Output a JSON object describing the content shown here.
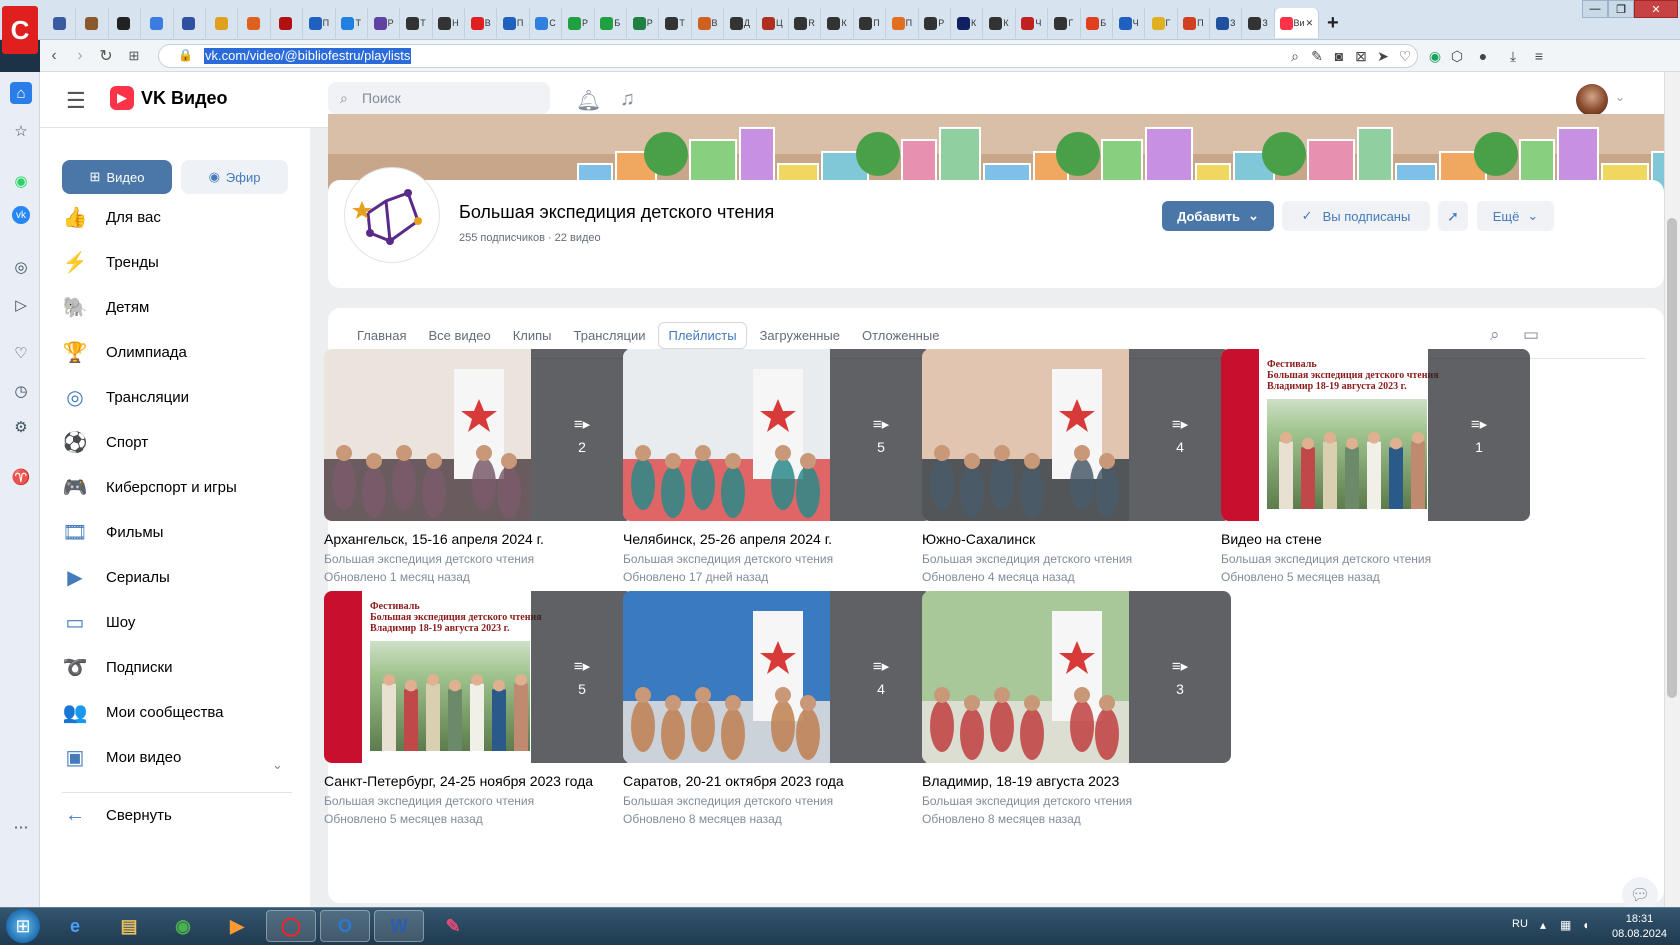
{
  "browser": {
    "logo": "С",
    "tabs": [
      {
        "label": "",
        "color": "#3a5ba0"
      },
      {
        "label": "",
        "color": "#8a5a2b"
      },
      {
        "label": "",
        "color": "#222222"
      },
      {
        "label": "",
        "color": "#3c7be0"
      },
      {
        "label": "",
        "color": "#3050a0"
      },
      {
        "label": "",
        "color": "#e0a020"
      },
      {
        "label": "",
        "color": "#e06020"
      },
      {
        "label": "",
        "color": "#b01010"
      },
      {
        "label": "П",
        "color": "#2060c0"
      },
      {
        "label": "Т",
        "color": "#2080e0"
      },
      {
        "label": "Р",
        "color": "#6040a0"
      },
      {
        "label": "Т",
        "color": "#333333"
      },
      {
        "label": "Н",
        "color": "#333333"
      },
      {
        "label": "В",
        "color": "#e02020"
      },
      {
        "label": "П",
        "color": "#2060c0"
      },
      {
        "label": "С",
        "color": "#3080e0"
      },
      {
        "label": "Р",
        "color": "#20a040"
      },
      {
        "label": "Б",
        "color": "#20a040"
      },
      {
        "label": "Р",
        "color": "#208040"
      },
      {
        "label": "Т",
        "color": "#333333"
      },
      {
        "label": "В",
        "color": "#d06020"
      },
      {
        "label": "Д",
        "color": "#333333"
      },
      {
        "label": "Ц",
        "color": "#b03020"
      },
      {
        "label": "R",
        "color": "#333333"
      },
      {
        "label": "К",
        "color": "#333333"
      },
      {
        "label": "П",
        "color": "#333333"
      },
      {
        "label": "П",
        "color": "#e07020"
      },
      {
        "label": "Р",
        "color": "#333333"
      },
      {
        "label": "К",
        "color": "#102060"
      },
      {
        "label": "К",
        "color": "#333333"
      },
      {
        "label": "Ч",
        "color": "#c02020"
      },
      {
        "label": "Г",
        "color": "#333333"
      },
      {
        "label": "Б",
        "color": "#e04020"
      },
      {
        "label": "Ч",
        "color": "#2060c0"
      },
      {
        "label": "Г",
        "color": "#e0b020"
      },
      {
        "label": "П",
        "color": "#d04020"
      },
      {
        "label": "З",
        "color": "#2050a0"
      },
      {
        "label": "З",
        "color": "#333333"
      }
    ],
    "active_tab": {
      "label": "Ви",
      "color": "#ff3347"
    },
    "new_tab": "+",
    "url": "vk.com/video/@bibliofestru/playlists"
  },
  "header": {
    "brand": "VK Видео",
    "search_placeholder": "Поиск"
  },
  "nav": {
    "btn_video": "Видео",
    "btn_efir": "Эфир",
    "items": [
      {
        "label": "Для вас",
        "icon": "thumb-up-icon",
        "glyph": "👍"
      },
      {
        "label": "Тренды",
        "icon": "lightning-icon",
        "glyph": "⚡"
      },
      {
        "label": "Детям",
        "icon": "kids-icon",
        "glyph": "🐘"
      },
      {
        "label": "Олимпиада",
        "icon": "trophy-icon",
        "glyph": "🏆"
      },
      {
        "label": "Трансляции",
        "icon": "live-icon",
        "glyph": "◎"
      },
      {
        "label": "Спорт",
        "icon": "ball-icon",
        "glyph": "⚽"
      },
      {
        "label": "Киберспорт и игры",
        "icon": "gamepad-icon",
        "glyph": "🎮"
      },
      {
        "label": "Фильмы",
        "icon": "film-icon",
        "glyph": "🎞"
      },
      {
        "label": "Сериалы",
        "icon": "series-icon",
        "glyph": "▶"
      },
      {
        "label": "Шоу",
        "icon": "tv-icon",
        "glyph": "▭"
      },
      {
        "label": "Подписки",
        "icon": "rss-icon",
        "glyph": "➰"
      },
      {
        "label": "Мои сообщества",
        "icon": "groups-icon",
        "glyph": "👥"
      },
      {
        "label": "Мои видео",
        "icon": "my-video-icon",
        "glyph": "▣"
      }
    ],
    "collapse": "Свернуть"
  },
  "group": {
    "name": "Большая экспедиция детского чтения",
    "meta": "255 подписчиков · 22 видео",
    "btn_add": "Добавить",
    "btn_subscribed": "Вы подписаны",
    "btn_more": "Ещё"
  },
  "tabs": [
    "Главная",
    "Все видео",
    "Клипы",
    "Трансляции",
    "Плейлисты",
    "Загруженные",
    "Отложенные"
  ],
  "active_tab": "Плейлисты",
  "playlists": [
    {
      "title": "Архангельск, 15-16 апреля 2024 г.",
      "author": "Большая экспедиция детского чтения",
      "updated": "Обновлено 1 месяц назад",
      "count": "2",
      "kind": "photo",
      "palette": [
        "#eae4dc",
        "#7a5a6a",
        "#4a3a3e"
      ]
    },
    {
      "title": "Челябинск, 25-26 апреля 2024 г.",
      "author": "Большая экспедиция детского чтения",
      "updated": "Обновлено 17 дней назад",
      "count": "5",
      "kind": "photo",
      "palette": [
        "#e8ecef",
        "#2a8a8a",
        "#d44"
      ]
    },
    {
      "title": "Южно-Сахалинск",
      "author": "Большая экспедиция детского чтения",
      "updated": "Обновлено 4 месяца назад",
      "count": "4",
      "kind": "photo",
      "palette": [
        "#e2c5b0",
        "#4a5a6a",
        "#2e3a44"
      ]
    },
    {
      "title": "Видео на стене",
      "author": "Большая экспедиция детского чтения",
      "updated": "Обновлено 5 месяцев назад",
      "count": "1",
      "kind": "festival",
      "fest_lines": [
        "Фестиваль",
        "Большая экспедиция детского чтения",
        "Владимир 18-19 августа 2023 г."
      ]
    },
    {
      "title": "Санкт-Петербург, 24-25 ноября 2023 года",
      "author": "Большая экспедиция детского чтения",
      "updated": "Обновлено 5 месяцев назад",
      "count": "5",
      "kind": "festival",
      "fest_lines": [
        "Фестиваль",
        "Большая экспедиция детского чтения",
        "Владимир 18-19 августа 2023 г."
      ]
    },
    {
      "title": "Саратов, 20-21 октября 2023 года",
      "author": "Большая экспедиция детского чтения",
      "updated": "Обновлено 8 месяцев назад",
      "count": "4",
      "kind": "photo",
      "palette": [
        "#3a7ac0",
        "#c08050",
        "#f0e8e0"
      ]
    },
    {
      "title": "Владимир, 18-19 августа 2023",
      "author": "Большая экспедиция детского чтения",
      "updated": "Обновлено 8 месяцев назад",
      "count": "3",
      "kind": "photo",
      "palette": [
        "#a8c89a",
        "#c04040",
        "#e8e4e0"
      ]
    }
  ],
  "taskbar": {
    "lang": "RU",
    "time": "18:31",
    "date": "08.08.2024"
  }
}
